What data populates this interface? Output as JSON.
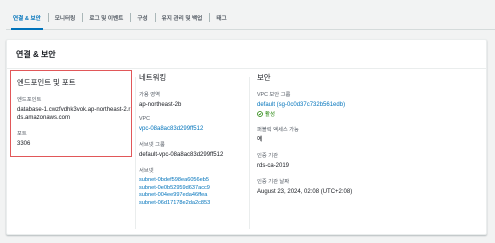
{
  "tabs": [
    {
      "label": "연결 & 보안",
      "active": true
    },
    {
      "label": "모니터링",
      "active": false
    },
    {
      "label": "로그 및 이벤트",
      "active": false
    },
    {
      "label": "구성",
      "active": false
    },
    {
      "label": "유지 관리 및 백업",
      "active": false
    },
    {
      "label": "태그",
      "active": false
    }
  ],
  "card": {
    "title": "연결 & 보안",
    "endpoint_port": {
      "title": "엔드포인트 및 포트",
      "endpoint_label": "엔드포인트",
      "endpoint_value": "database-1.cwzfvdhk3vok.ap-northeast-2.rds.amazonaws.com",
      "port_label": "포트",
      "port_value": "3306"
    },
    "networking": {
      "title": "네트워킹",
      "az_label": "가용 영역",
      "az_value": "ap-northeast-2b",
      "vpc_label": "VPC",
      "vpc_value": "vpc-08a8ac83d299ff512",
      "subnet_group_label": "서브넷 그룹",
      "subnet_group_value": "default-vpc-08a8ac83d299ff512",
      "subnets_label": "서브넷",
      "subnets": [
        "subnet-0bdef598ea6056eb5",
        "subnet-0e0b52959d637acc9",
        "subnet-004ee997eda46ffea",
        "subnet-06d17178e2da2c853"
      ]
    },
    "security": {
      "title": "보안",
      "sg_label": "VPC 보안 그룹",
      "sg_value": "default (sg-0c0d37c732b561edb)",
      "sg_status": "활성",
      "public_label": "퍼블릭 액세스 가능",
      "public_value": "예",
      "ca_label": "인증 기관",
      "ca_value": "rds-ca-2019",
      "ca_expiry_label": "인증 기관 날짜",
      "ca_expiry_value": "August 23, 2024, 02:08 (UTC+2:08)"
    }
  },
  "colors": {
    "accent": "#0073bb",
    "success": "#1d8102",
    "highlight_border": "#e15759"
  }
}
